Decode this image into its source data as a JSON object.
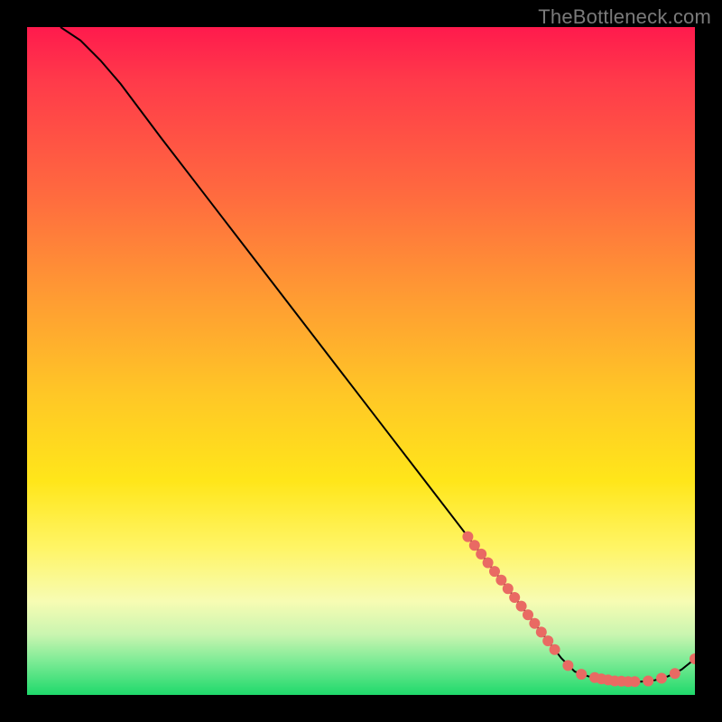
{
  "watermark": "TheBottleneck.com",
  "chart_data": {
    "type": "line",
    "title": "",
    "xlabel": "",
    "ylabel": "",
    "xlim": [
      0,
      100
    ],
    "ylim": [
      0,
      100
    ],
    "grid": false,
    "legend": false,
    "curve_description": "Starts at top-left (~x=5,y=100), gentle shoulder, then near-linear descent to roughly (x=80,y=3), flattens along bottom, slight uptick at far right.",
    "curve": [
      {
        "x": 5,
        "y": 100
      },
      {
        "x": 8,
        "y": 98
      },
      {
        "x": 11,
        "y": 95
      },
      {
        "x": 14,
        "y": 91.5
      },
      {
        "x": 17,
        "y": 87.5
      },
      {
        "x": 20,
        "y": 83.5
      },
      {
        "x": 25,
        "y": 77
      },
      {
        "x": 30,
        "y": 70.5
      },
      {
        "x": 35,
        "y": 64
      },
      {
        "x": 40,
        "y": 57.5
      },
      {
        "x": 45,
        "y": 51
      },
      {
        "x": 50,
        "y": 44.5
      },
      {
        "x": 55,
        "y": 38
      },
      {
        "x": 60,
        "y": 31.5
      },
      {
        "x": 65,
        "y": 25
      },
      {
        "x": 70,
        "y": 18.5
      },
      {
        "x": 75,
        "y": 12
      },
      {
        "x": 80,
        "y": 5.5
      },
      {
        "x": 82,
        "y": 3.5
      },
      {
        "x": 84,
        "y": 2.8
      },
      {
        "x": 86,
        "y": 2.4
      },
      {
        "x": 88,
        "y": 2.1
      },
      {
        "x": 90,
        "y": 2.0
      },
      {
        "x": 92,
        "y": 2.0
      },
      {
        "x": 94,
        "y": 2.2
      },
      {
        "x": 96,
        "y": 2.8
      },
      {
        "x": 98,
        "y": 3.8
      },
      {
        "x": 100,
        "y": 5.4
      }
    ],
    "series": [
      {
        "name": "markers",
        "type": "scatter",
        "color": "#e96a63",
        "points": [
          {
            "x": 66,
            "y": 23.7
          },
          {
            "x": 67,
            "y": 22.4
          },
          {
            "x": 68,
            "y": 21.1
          },
          {
            "x": 69,
            "y": 19.8
          },
          {
            "x": 70,
            "y": 18.5
          },
          {
            "x": 71,
            "y": 17.2
          },
          {
            "x": 72,
            "y": 15.9
          },
          {
            "x": 73,
            "y": 14.6
          },
          {
            "x": 74,
            "y": 13.3
          },
          {
            "x": 75,
            "y": 12.0
          },
          {
            "x": 76,
            "y": 10.7
          },
          {
            "x": 77,
            "y": 9.4
          },
          {
            "x": 78,
            "y": 8.1
          },
          {
            "x": 79,
            "y": 6.8
          },
          {
            "x": 81,
            "y": 4.4
          },
          {
            "x": 83,
            "y": 3.1
          },
          {
            "x": 85,
            "y": 2.6
          },
          {
            "x": 86,
            "y": 2.4
          },
          {
            "x": 87,
            "y": 2.25
          },
          {
            "x": 88,
            "y": 2.1
          },
          {
            "x": 89,
            "y": 2.05
          },
          {
            "x": 90,
            "y": 2.0
          },
          {
            "x": 91,
            "y": 2.0
          },
          {
            "x": 93,
            "y": 2.1
          },
          {
            "x": 95,
            "y": 2.5
          },
          {
            "x": 97,
            "y": 3.2
          },
          {
            "x": 100,
            "y": 5.4
          }
        ]
      }
    ]
  }
}
